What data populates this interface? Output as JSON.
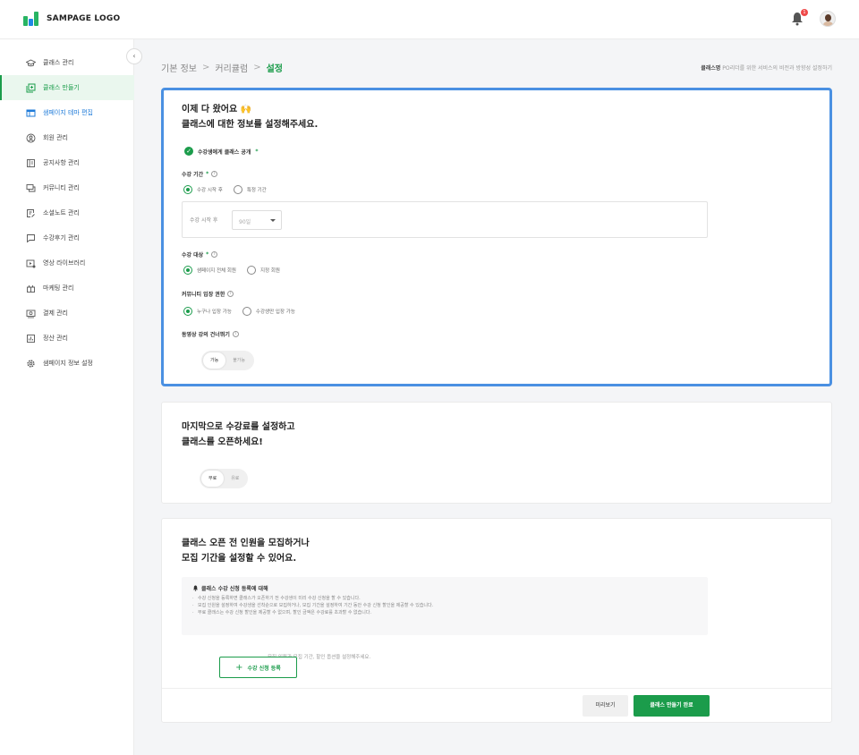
{
  "header": {
    "logo_text": "SAMPAGE LOGO",
    "notification_count": "1",
    "brand_color": "#1b9c4b"
  },
  "sidebar": {
    "items": [
      {
        "label": "클래스 관리",
        "icon": "graduation-cap-icon"
      },
      {
        "label": "클래스 만들기",
        "icon": "copy-add-icon",
        "active": true
      },
      {
        "label": "샘페이지 테마 편집",
        "icon": "layout-icon",
        "highlight": true
      },
      {
        "label": "회원 관리",
        "icon": "user-circle-icon"
      },
      {
        "label": "공지사항 관리",
        "icon": "notice-board-icon"
      },
      {
        "label": "커뮤니티 관리",
        "icon": "chat-icon"
      },
      {
        "label": "소셜노트 관리",
        "icon": "note-edit-icon"
      },
      {
        "label": "수강후기 관리",
        "icon": "comment-icon"
      },
      {
        "label": "영상 라이브러리",
        "icon": "video-library-icon"
      },
      {
        "label": "마케팅 관리",
        "icon": "gift-icon"
      },
      {
        "label": "결제 관리",
        "icon": "payment-icon"
      },
      {
        "label": "정산 관리",
        "icon": "settlement-icon"
      },
      {
        "label": "샘페이지 정보 설정",
        "icon": "gear-icon"
      }
    ]
  },
  "breadcrumb": {
    "items": [
      "기본 정보",
      "커리큘럼",
      "설정"
    ],
    "sep": ">"
  },
  "class_name": {
    "label": "클래스명",
    "value": "PO리더를 위한 서비스의 비전과 방향성 설정하기"
  },
  "settings_card": {
    "title": "이제 다 왔어요 🙌\n클래스에 대한 정보를 설정해주세요.",
    "publish_label": "수강생에게 클래스 공개",
    "required_mark": "*",
    "period": {
      "label": "수강 기간",
      "options": [
        "수강 시작 후",
        "특정 기간"
      ],
      "selected": "수강 시작 후",
      "box_label": "수강 시작 후",
      "select_value": "90일"
    },
    "target": {
      "label": "수강 대상",
      "options": [
        "샘페이지 전체 회원",
        "지정 회원"
      ]
    },
    "community": {
      "label": "커뮤니티 입장 권한",
      "options": [
        "누구나 입장 가능",
        "수강생만 입장 가능"
      ]
    },
    "skip": {
      "label": "동영상 강의 건너뛰기",
      "options": [
        "가능",
        "불가능"
      ]
    }
  },
  "price_card": {
    "title": "마지막으로 수강료를 설정하고\n클래스를 오픈하세요!",
    "options": [
      "무료",
      "유료"
    ]
  },
  "recruit_card": {
    "title": "클래스 오픈 전 인원을 모집하거나\n모집 기간을 설정할 수 있어요.",
    "notice_title": "클래스 수강 신청 등록에 대해",
    "notice_items": [
      "수강 신청을 등록하면 클래스가 오픈하기 전 수강생이 미리 수강 신청을 할 수 있습니다.",
      "모집 인원을 설정하여 수강생을 선착순으로 모집하거나, 모집 기간을 설정하여 기간 동안 수강 신청 할인을 제공할 수 있습니다.",
      "무료 클래스는 수강 신청 할인을 제공할 수 없으며, 할인 금액은 수강료를 초과할 수 없습니다."
    ],
    "hint": "모집 인원과 모집 기간, 할인 옵션을 설정해주세요.",
    "register_button": "수강 신청 등록",
    "preview_button": "미리보기",
    "finish_button": "클래스 만들기 완료"
  }
}
